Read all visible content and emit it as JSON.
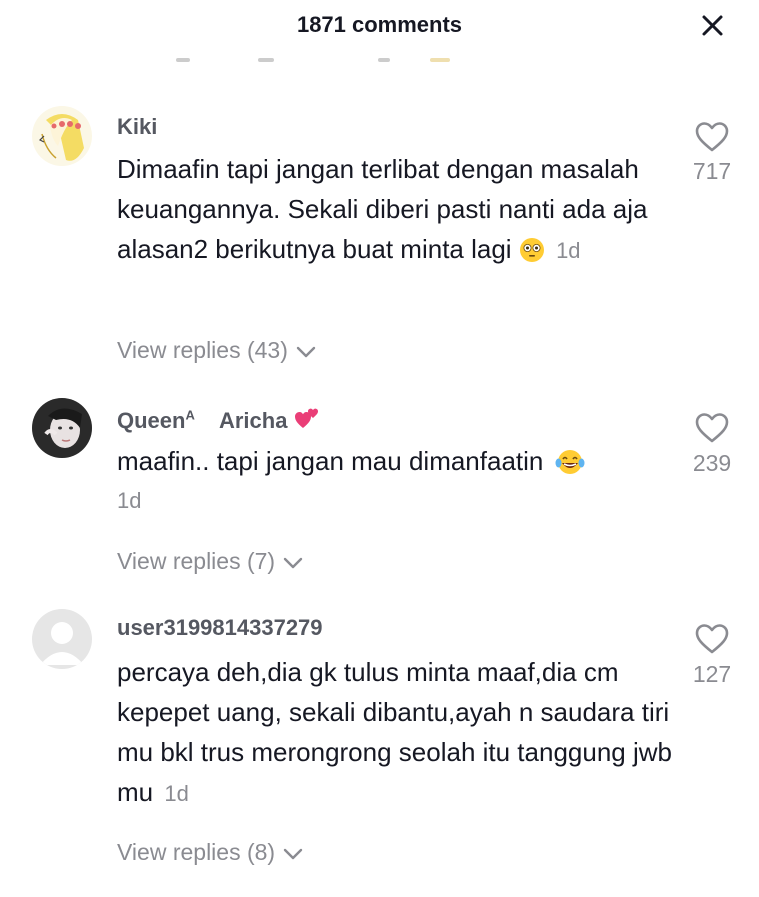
{
  "header": {
    "title": "1871 comments",
    "close_icon": "close-icon"
  },
  "comments": [
    {
      "username": "Kiki",
      "text": "Dimaafin tapi jangan terlibat dengan masalah keuangannya. Sekali diberi pasti nanti ada aja alasan2 berikutnya buat minta lagi",
      "emoji": "flushed-face-emoji",
      "time": "1d",
      "likes": "717",
      "replies_label": "View replies (43)"
    },
    {
      "username": "Queen",
      "username_sup": "A",
      "username_extra": "Aricha",
      "username_emoji": "two-hearts-emoji",
      "text": "maafin.. tapi jangan mau dimanfaatin",
      "emoji": "tears-of-joy-emoji",
      "time": "1d",
      "likes": "239",
      "replies_label": "View replies (7)"
    },
    {
      "username": "user3199814337279",
      "text": "percaya deh,dia gk tulus minta maaf,dia cm kepepet uang, sekali dibantu,ayah n saudara tiri mu bkl trus merongrong seolah itu tanggung jwb mu",
      "time": "1d",
      "likes": "127",
      "replies_label": "View replies (8)"
    }
  ],
  "colors": {
    "primary_text": "#161823",
    "secondary_text": "#8a8b91",
    "username": "#555861",
    "background": "#ffffff"
  }
}
